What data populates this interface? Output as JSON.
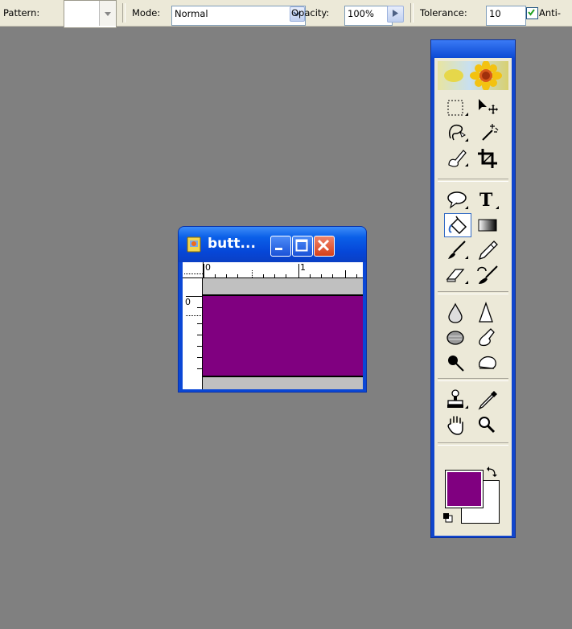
{
  "options_bar": {
    "pattern_label": "Pattern:",
    "mode_label": "Mode:",
    "mode_value": "Normal",
    "opacity_label": "Opacity:",
    "opacity_value": "100%",
    "tolerance_label": "Tolerance:",
    "tolerance_value": "10",
    "antialias_label": "Anti-"
  },
  "document": {
    "title": "butt...",
    "ruler_h_labels": [
      "0",
      "1"
    ],
    "ruler_v_label": "0",
    "canvas_color": "#800080"
  },
  "tools_panel": {
    "tools": [
      [
        "rectangular-marquee-icon",
        "move-icon"
      ],
      [
        "lasso-icon",
        "magic-wand-icon"
      ],
      [
        "healing-brush-icon",
        "crop-icon"
      ],
      [
        "shape-icon",
        "type-icon"
      ],
      [
        "paint-bucket-icon",
        "gradient-icon"
      ],
      [
        "brush-icon",
        "pencil-icon"
      ],
      [
        "eraser-icon",
        "history-brush-icon"
      ],
      [
        "blur-icon",
        "sharpen-icon"
      ],
      [
        "dodge-icon",
        "smudge-icon"
      ],
      [
        "burn-icon",
        "sponge-icon"
      ],
      [
        "stamp-icon",
        "eyedropper-icon"
      ],
      [
        "hand-icon",
        "zoom-icon"
      ]
    ],
    "selected_tool": "paint-bucket-icon",
    "foreground_color": "#800080",
    "background_color": "#ffffff"
  }
}
